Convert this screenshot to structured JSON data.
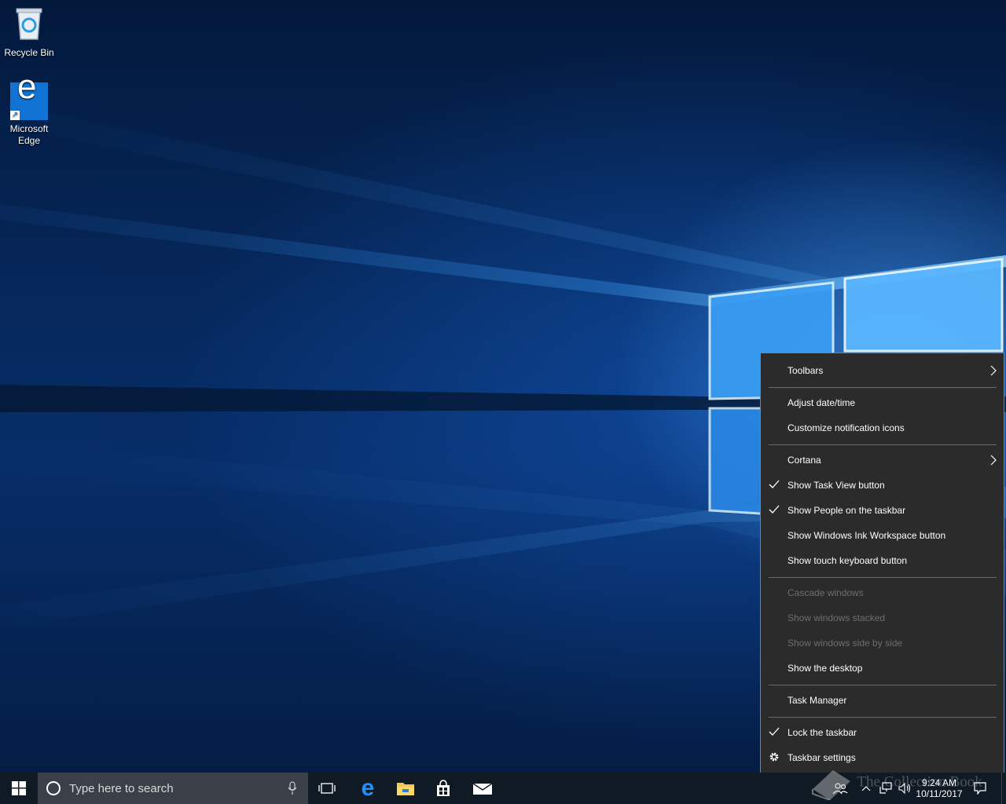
{
  "desktop": {
    "icons": [
      {
        "label": "Recycle Bin"
      },
      {
        "label": "Microsoft Edge"
      }
    ]
  },
  "context_menu": {
    "items": [
      {
        "label": "Toolbars",
        "submenu": true
      },
      {
        "label": "Adjust date/time"
      },
      {
        "label": "Customize notification icons"
      },
      {
        "label": "Cortana",
        "submenu": true
      },
      {
        "label": "Show Task View button",
        "checked": true
      },
      {
        "label": "Show People on the taskbar",
        "checked": true
      },
      {
        "label": "Show Windows Ink Workspace button"
      },
      {
        "label": "Show touch keyboard button"
      },
      {
        "label": "Cascade windows",
        "disabled": true
      },
      {
        "label": "Show windows stacked",
        "disabled": true
      },
      {
        "label": "Show windows side by side",
        "disabled": true
      },
      {
        "label": "Show the desktop"
      },
      {
        "label": "Task Manager"
      },
      {
        "label": "Lock the taskbar",
        "checked": true
      },
      {
        "label": "Taskbar settings",
        "icon": "gear-icon"
      }
    ]
  },
  "taskbar": {
    "search_placeholder": "Type here to search",
    "time": "9:24 AM",
    "date": "10/11/2017"
  },
  "watermark": "The Collection Book",
  "colors": {
    "menu_bg": "#2b2b2b",
    "taskbar_bg": "#101a24",
    "search_bg": "#3b4048",
    "disabled_text": "#6e6e6e"
  }
}
